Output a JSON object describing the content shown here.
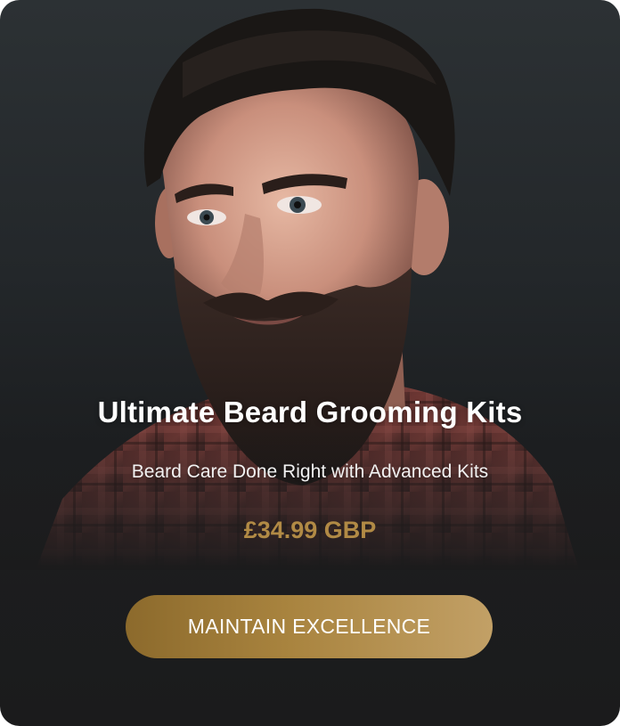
{
  "card": {
    "image": {
      "icon": "bearded-man-portrait"
    },
    "title": "Ultimate Beard Grooming Kits",
    "subtitle": "Beard Care Done Right with Advanced Kits",
    "price": "£34.99 GBP",
    "cta_label": "MAINTAIN EXCELLENCE"
  },
  "colors": {
    "background_top": "#2c3134",
    "background_bottom": "#1b1b1c",
    "accent_gold": "#b18a45",
    "button_gold_start": "#8c6a2c",
    "button_gold_end": "#c2a066",
    "text": "#ffffff"
  }
}
